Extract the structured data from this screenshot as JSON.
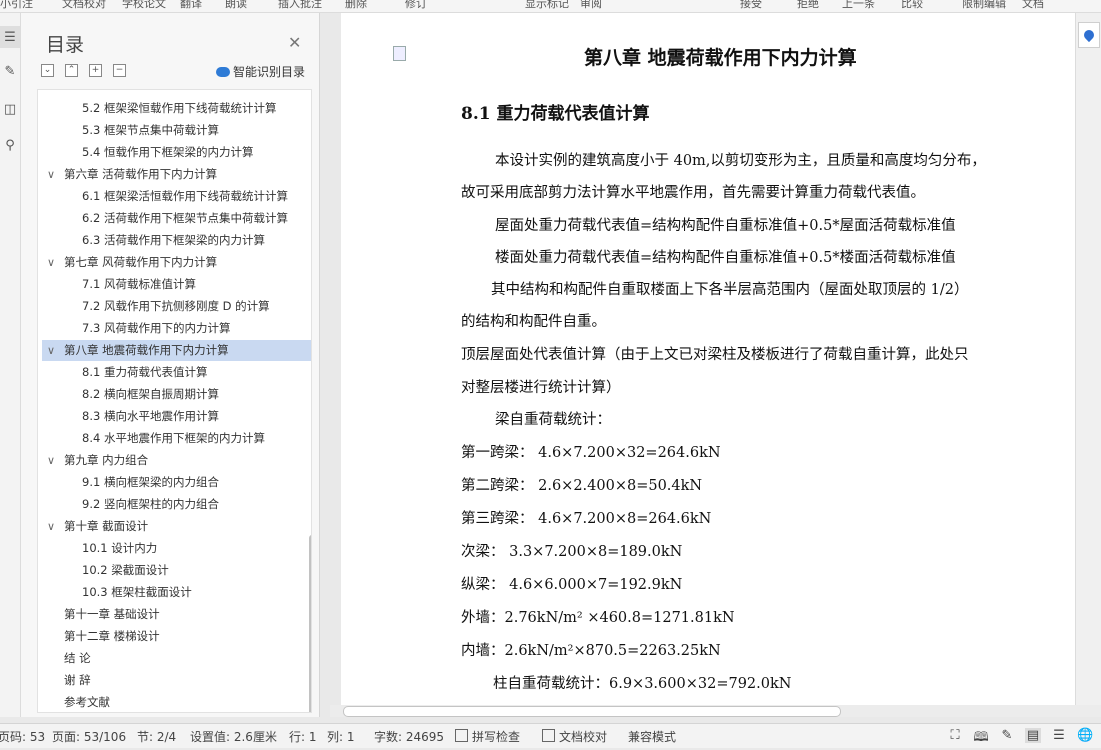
{
  "toolbar_fragments": [
    "小引注",
    "文档校对",
    "学校论文",
    "翻译",
    "朗读",
    "插入批注",
    "删除",
    "修订",
    "显示标记",
    "审阅",
    "接受",
    "拒绝",
    "上一条",
    "比较",
    "限制编辑",
    "文档"
  ],
  "sidebar": {
    "title": "目录",
    "smart_label": "智能识别目录",
    "toc": [
      {
        "text": "5.2 框架梁恒载作用下线荷载统计计算",
        "level": 2
      },
      {
        "text": "5.3 框架节点集中荷载计算",
        "level": 2
      },
      {
        "text": "5.4 恒载作用下框架梁的内力计算",
        "level": 2
      },
      {
        "text": "第六章 活荷载作用下内力计算",
        "level": 1,
        "expanded": true
      },
      {
        "text": "6.1 框架梁活恒载作用下线荷载统计计算",
        "level": 2
      },
      {
        "text": "6.2 活荷载作用下框架节点集中荷载计算",
        "level": 2
      },
      {
        "text": "6.3 活荷载作用下框架梁的内力计算",
        "level": 2
      },
      {
        "text": "第七章 风荷载作用下内力计算",
        "level": 1,
        "expanded": true
      },
      {
        "text": "7.1 风荷载标准值计算",
        "level": 2
      },
      {
        "text": "7.2 风载作用下抗侧移刚度 D 的计算",
        "level": 2
      },
      {
        "text": "7.3 风荷载作用下的内力计算",
        "level": 2
      },
      {
        "text": "第八章 地震荷载作用下内力计算",
        "level": 1,
        "expanded": true,
        "selected": true
      },
      {
        "text": "8.1 重力荷载代表值计算",
        "level": 2
      },
      {
        "text": "8.2 横向框架自振周期计算",
        "level": 2
      },
      {
        "text": "8.3 横向水平地震作用计算",
        "level": 2
      },
      {
        "text": "8.4 水平地震作用下框架的内力计算",
        "level": 2
      },
      {
        "text": "第九章 内力组合",
        "level": 1,
        "expanded": true
      },
      {
        "text": "9.1 横向框架梁的内力组合",
        "level": 2
      },
      {
        "text": "9.2 竖向框架柱的内力组合",
        "level": 2
      },
      {
        "text": "第十章 截面设计",
        "level": 1,
        "expanded": true
      },
      {
        "text": "10.1 设计内力",
        "level": 2
      },
      {
        "text": "10.2 梁截面设计",
        "level": 2
      },
      {
        "text": "10.3 框架柱截面设计",
        "level": 2
      },
      {
        "text": "第十一章 基础设计",
        "level": 1
      },
      {
        "text": "第十二章 楼梯设计",
        "level": 1
      },
      {
        "text": "结 论",
        "level": 1
      },
      {
        "text": "谢 辞",
        "level": 1
      },
      {
        "text": "参考文献",
        "level": 1
      }
    ]
  },
  "document": {
    "chapter_title": "第八章  地震荷载作用下内力计算",
    "section_title": "8.1  重力荷载代表值计算",
    "lines": [
      "本设计实例的建筑高度小于 40m,以剪切变形为主，且质量和高度均匀分布，",
      "故可采用底部剪力法计算水平地震作用，首先需要计算重力荷载代表值。",
      "屋面处重力荷载代表值=结构构配件自重标准值+0.5*屋面活荷载标准值",
      "楼面处重力荷载代表值=结构构配件自重标准值+0.5*楼面活荷载标准值",
      "其中结构和构配件自重取楼面上下各半层高范围内（屋面处取顶层的 1/2）",
      "的结构和构配件自重。",
      "顶层屋面处代表值计算（由于上文已对梁柱及楼板进行了荷载自重计算，此处只",
      "对整层楼进行统计计算）",
      "梁自重荷载统计：",
      "第一跨梁：  4.6×7.200×32=264.6kN",
      "第二跨梁：  2.6×2.400×8=50.4kN",
      "第三跨梁：  4.6×7.200×8=264.6kN",
      "次梁：  3.3×7.200×8=189.0kN",
      "纵梁：  4.6×6.000×7=192.9kN",
      "外墙：2.76kN/m²  ×460.8=1271.81kN",
      "内墙：2.6kN/m²×870.5=2263.25kN",
      "柱自重荷载统计：6.9×3.600×32=792.0kN"
    ]
  },
  "status_bar": {
    "page_code": "页码: 53",
    "page": "页面: 53/106",
    "section": "节: 2/4",
    "setting": "设置值: 2.6厘米",
    "row": "行: 1",
    "col": "列: 1",
    "word_count": "字数: 24695",
    "spell_check": "拼写检查",
    "doc_check": "文档校对",
    "compat_mode": "兼容模式"
  },
  "icons": [
    "toc-icon",
    "comment-icon",
    "bookmark-icon",
    "search-icon",
    "close-icon",
    "location-pin-icon",
    "fullscreen-icon",
    "read-mode-icon",
    "edit-icon",
    "page-view-icon",
    "outline-icon",
    "web-view-icon"
  ]
}
